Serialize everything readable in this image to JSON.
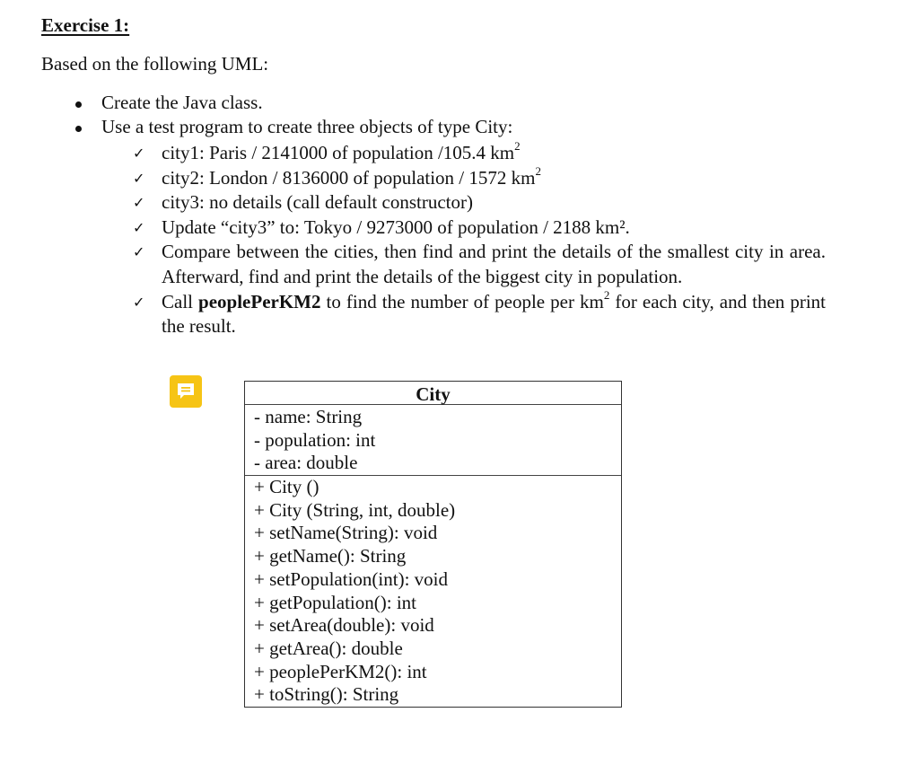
{
  "document": {
    "heading": "Exercise 1:",
    "intro": "Based on the following UML:",
    "bullets": [
      "Create the Java class.",
      "Use a test program to create three objects of type City:"
    ],
    "checklist": [
      {
        "pre": "city1: Paris / 2141000 of population /105.4 km",
        "sup": "2",
        "post": ""
      },
      {
        "pre": "city2: London / 8136000 of population / 1572 km",
        "sup": "2",
        "post": ""
      },
      {
        "pre": "city3: no details (call default constructor)",
        "sup": "",
        "post": ""
      },
      {
        "pre": "Update “city3” to: Tokyo / 9273000 of population / 2188 km².",
        "sup": "",
        "post": ""
      },
      {
        "pre": "Compare between the cities, then find and print the details of the smallest city in area. Afterward, find and print the details of the biggest city in population.",
        "sup": "",
        "post": ""
      },
      {
        "pre_a": "Call ",
        "bold": "peoplePerKM2",
        "pre_b": " to find the number of people per km",
        "sup": "2",
        "post": " for each city, and then print the result."
      }
    ],
    "check_icon": "check-mark-icon",
    "comment_icon": "comment-note-icon",
    "comment_icon_color": "#f6c415"
  },
  "uml": {
    "class_name": "City",
    "attributes": [
      "- name: String",
      "- population: int",
      "- area: double"
    ],
    "methods": [
      "+ City ()",
      "+ City (String, int, double)",
      "+ setName(String): void",
      "+ getName(): String",
      "+ setPopulation(int): void",
      "+ getPopulation(): int",
      "+ setArea(double): void",
      "+ getArea(): double",
      "+ peoplePerKM2(): int",
      "+ toString(): String"
    ]
  }
}
